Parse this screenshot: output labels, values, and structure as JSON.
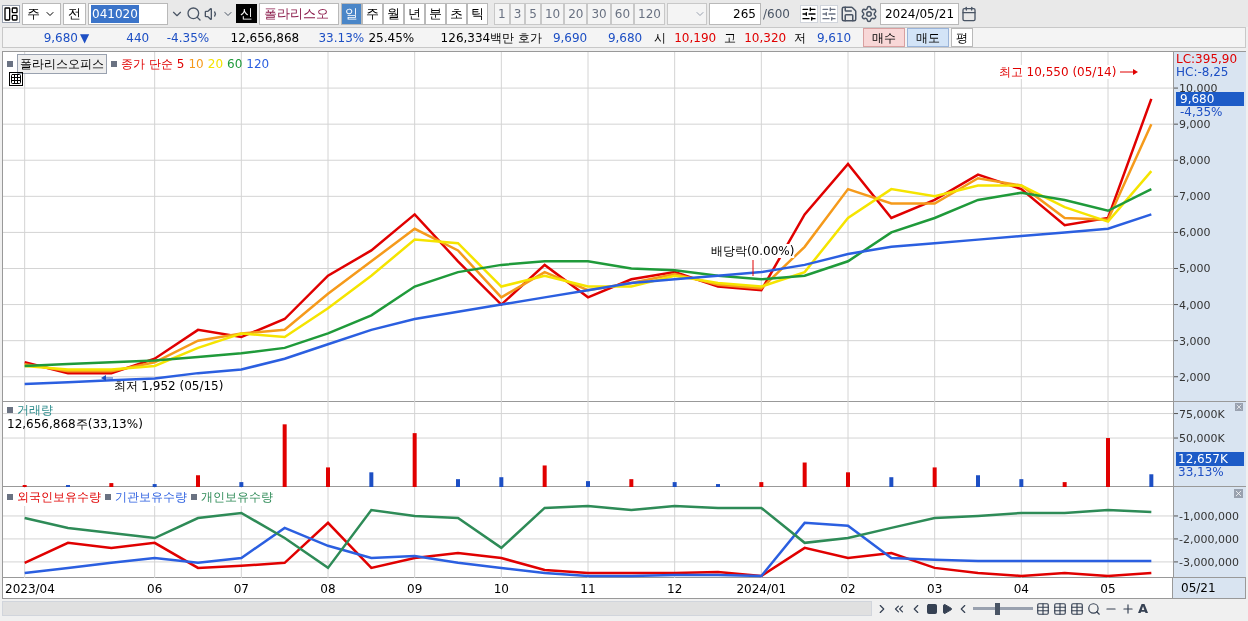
{
  "toolbar": {
    "market": "주",
    "scope": "전",
    "code": "041020",
    "badge": "신",
    "name": "폴라리스오",
    "periods": [
      {
        "label": "일",
        "selected": true
      },
      {
        "label": "주",
        "selected": false
      },
      {
        "label": "월",
        "selected": false
      },
      {
        "label": "년",
        "selected": false
      },
      {
        "label": "분",
        "selected": false
      },
      {
        "label": "초",
        "selected": false
      },
      {
        "label": "틱",
        "selected": false
      }
    ],
    "intervals": [
      {
        "label": "1",
        "selected": false
      },
      {
        "label": "3",
        "selected": false
      },
      {
        "label": "5",
        "selected": false
      },
      {
        "label": "10",
        "selected": false
      },
      {
        "label": "20",
        "selected": false
      },
      {
        "label": "30",
        "selected": false
      },
      {
        "label": "60",
        "selected": false
      },
      {
        "label": "120",
        "selected": false
      }
    ],
    "count": "265",
    "max": "/600",
    "date": "2024/05/21"
  },
  "quote": {
    "price": "9,680",
    "direction": "▼",
    "change": "440",
    "change_pct": "-4.35%",
    "volume": "12,656,868",
    "volume_ratio": "33.13%",
    "turnover": "25.45%",
    "amount": "126,334백만",
    "bid_label": "호가",
    "ask": "9,690",
    "bid": "9,680",
    "open_label": "시",
    "open": "10,190",
    "high_label": "고",
    "high": "10,320",
    "low_label": "저",
    "low": "9,610",
    "buy": "매수",
    "sell": "매도",
    "avg": "평"
  },
  "price_panel": {
    "name": "폴라리스오피스",
    "ma_label": "종가 단순",
    "lc": "LC:395,90",
    "hc": "HC:-8,25",
    "current": "9,680",
    "current_change": "-4,35%",
    "chart_data": {
      "type": "line",
      "grid": true,
      "ylim": [
        1300,
        11000
      ],
      "yticks": [
        {
          "value": 2000,
          "label": "2,000"
        },
        {
          "value": 3000,
          "label": "3,000"
        },
        {
          "value": 4000,
          "label": "4,000"
        },
        {
          "value": 5000,
          "label": "5,000"
        },
        {
          "value": 6000,
          "label": "6,000"
        },
        {
          "value": 7000,
          "label": "7,000"
        },
        {
          "value": 8000,
          "label": "8,000"
        },
        {
          "value": 9000,
          "label": "9,000"
        },
        {
          "value": 10000,
          "label": "10,000"
        }
      ],
      "series": [
        {
          "name": "5",
          "color": "#e00000",
          "values": [
            2400,
            2100,
            2100,
            2500,
            3300,
            3100,
            3600,
            4800,
            5500,
            6500,
            5200,
            4000,
            5100,
            4200,
            4700,
            4900,
            4500,
            4400,
            6500,
            7900,
            6400,
            6900,
            7600,
            7200,
            6200,
            6400,
            9700
          ]
        },
        {
          "name": "10",
          "color": "#f59a1b",
          "values": [
            2350,
            2150,
            2150,
            2400,
            3000,
            3200,
            3300,
            4300,
            5200,
            6100,
            5500,
            4200,
            4900,
            4400,
            4600,
            4850,
            4550,
            4450,
            5600,
            7200,
            6800,
            6800,
            7500,
            7300,
            6400,
            6350,
            9000
          ]
        },
        {
          "name": "20",
          "color": "#f5e400",
          "values": [
            2300,
            2200,
            2200,
            2300,
            2800,
            3200,
            3100,
            3900,
            4800,
            5800,
            5700,
            4500,
            4800,
            4500,
            4500,
            4800,
            4600,
            4500,
            4900,
            6400,
            7200,
            7000,
            7300,
            7300,
            6700,
            6300,
            7700
          ]
        },
        {
          "name": "60",
          "color": "#1f9a3a",
          "values": [
            2300,
            2350,
            2400,
            2450,
            2550,
            2650,
            2800,
            3200,
            3700,
            4500,
            4900,
            5100,
            5200,
            5200,
            5000,
            4950,
            4800,
            4700,
            4800,
            5200,
            6000,
            6400,
            6900,
            7100,
            6900,
            6600,
            7200
          ]
        },
        {
          "name": "120",
          "color": "#2b5fe0",
          "values": [
            1800,
            1850,
            1900,
            1950,
            2100,
            2200,
            2500,
            2900,
            3300,
            3600,
            3800,
            4000,
            4200,
            4400,
            4600,
            4700,
            4800,
            4900,
            5100,
            5400,
            5600,
            5700,
            5800,
            5900,
            6000,
            6100,
            6500
          ]
        }
      ],
      "annotations": [
        "최고 10,550 (05/14)",
        "최저 1,952 (05/15)",
        "배당락(0.00%)"
      ]
    }
  },
  "volume_panel": {
    "title": "거래량",
    "summary": "12,656,868주(33,13%)",
    "current": "12,657K",
    "current_ratio": "33,13%",
    "chart_data": {
      "type": "bar",
      "grid": true,
      "ylim": [
        0,
        86800
      ],
      "yticks": [
        {
          "value": 50000,
          "label": "50,000K"
        },
        {
          "value": 75000,
          "label": "75,000K"
        }
      ],
      "series": [
        {
          "color": "#e00000",
          "values": [
            2000,
            null,
            4000,
            null,
            12000,
            null,
            64000,
            20000,
            null,
            55000,
            null,
            null,
            22000,
            null,
            8000,
            null,
            null,
            5000,
            25000,
            15000,
            null,
            20000,
            null,
            null,
            5000,
            50000,
            null
          ]
        },
        {
          "color": "#1d4fc4",
          "values": [
            null,
            2000,
            null,
            3000,
            null,
            5000,
            null,
            null,
            15000,
            null,
            8000,
            10000,
            null,
            6000,
            null,
            5000,
            3000,
            null,
            null,
            null,
            10000,
            null,
            12000,
            8000,
            null,
            null,
            13000
          ]
        }
      ]
    }
  },
  "holdings_panel": {
    "chart_data": {
      "type": "line",
      "grid": true,
      "categories": [
        "2023/04",
        null,
        null,
        "06",
        null,
        "07",
        null,
        "08",
        null,
        "09",
        null,
        "10",
        null,
        "11",
        null,
        "12",
        null,
        "2024/01",
        null,
        "02",
        null,
        "03",
        null,
        "04",
        null,
        "05",
        null
      ],
      "ylim": [
        -3700000,
        260000
      ],
      "yticks": [
        {
          "value": -1000000,
          "label": "-1,000,000"
        },
        {
          "value": -2000000,
          "label": "-2,000,000"
        },
        {
          "value": -3000000,
          "label": "-3,000,000"
        }
      ],
      "series": [
        {
          "name": "외국인보유수량",
          "color": "#e00000",
          "values": [
            -3040000,
            -2170000,
            -2390000,
            -2170000,
            -3260000,
            -3170000,
            -3040000,
            -1300000,
            -3260000,
            -2830000,
            -2610000,
            -2830000,
            -3350000,
            -3480000,
            -3480000,
            -3480000,
            -3440000,
            -3610000,
            -2390000,
            -2830000,
            -2610000,
            -3260000,
            -3480000,
            -3610000,
            -3480000,
            -3610000,
            -3480000
          ]
        },
        {
          "name": "기관보유수량",
          "color": "#2b5fe0",
          "values": [
            -3480000,
            -3260000,
            -3040000,
            -2830000,
            -3040000,
            -2830000,
            -1520000,
            -2300000,
            -2830000,
            -2740000,
            -3040000,
            -3260000,
            -3480000,
            -3610000,
            -3610000,
            -3570000,
            -3570000,
            -3610000,
            -1300000,
            -1430000,
            -2830000,
            -2910000,
            -2960000,
            -2960000,
            -2960000,
            -2960000,
            -2960000
          ]
        },
        {
          "name": "개인보유수량",
          "color": "#2e8b57",
          "values": [
            -1090000,
            -1520000,
            -1740000,
            -1960000,
            -1090000,
            -870000,
            -1960000,
            -3260000,
            -740000,
            -1000000,
            -1090000,
            -2390000,
            -650000,
            -570000,
            -740000,
            -570000,
            -650000,
            -650000,
            -2170000,
            -1960000,
            -1520000,
            -1090000,
            -1000000,
            -870000,
            -870000,
            -740000,
            -830000
          ]
        }
      ]
    }
  },
  "last_date": "05/21",
  "speed_slider": {
    "level": 0.4
  },
  "zoom_reset": "A"
}
